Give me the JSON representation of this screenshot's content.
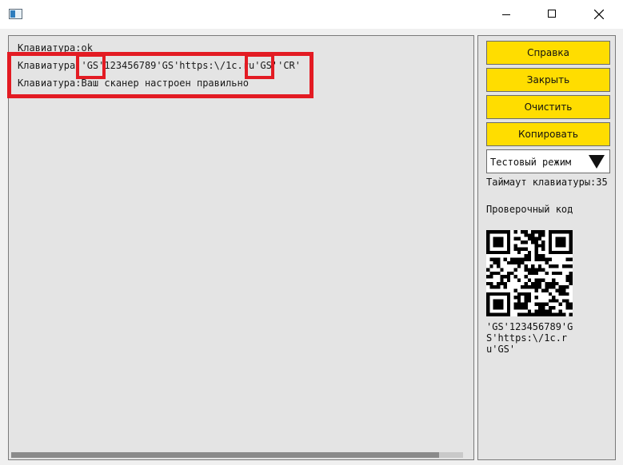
{
  "window": {
    "icons": {
      "app": "app-window-icon",
      "minimize": "minimize-icon",
      "maximize": "maximize-icon",
      "close": "close-icon"
    }
  },
  "log": {
    "lines": [
      "Клавиатура:ok",
      "Клавиатура:'GS'123456789'GS'https:\\/1c.ru'GS''CR'",
      "Клавиатура:Ваш сканер настроен правильно"
    ],
    "highlight_color": "#e31b23"
  },
  "buttons": {
    "help": "Справка",
    "close": "Закрыть",
    "clear": "Очистить",
    "copy": "Копировать",
    "color": "#ffdd00"
  },
  "mode": {
    "selected": "Тестовый режим",
    "icon": "dropdown-triangle-icon"
  },
  "timeout_text": "Таймаут клавиатуры:35",
  "check_code": {
    "label": "Проверочный код",
    "code_text": "'GS'123456789'GS'https:\\/1c.ru'GS'"
  }
}
